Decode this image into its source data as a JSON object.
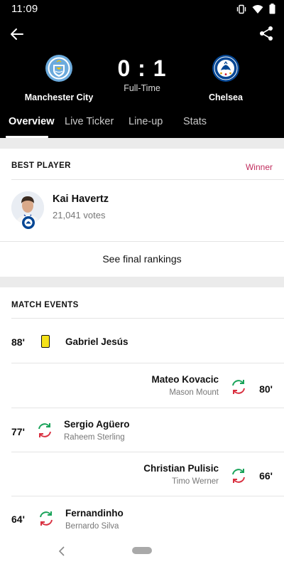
{
  "status_bar": {
    "time": "11:09"
  },
  "match": {
    "home": {
      "name": "Manchester City"
    },
    "away": {
      "name": "Chelsea"
    },
    "score": "0 : 1",
    "status": "Full-Time"
  },
  "tabs": [
    {
      "label": "Overview",
      "active": true
    },
    {
      "label": "Live Ticker",
      "active": false
    },
    {
      "label": "Line-up",
      "active": false
    },
    {
      "label": "Stats",
      "active": false
    }
  ],
  "best_player": {
    "section_title": "BEST PLAYER",
    "winner_label": "Winner",
    "name": "Kai Havertz",
    "votes": "21,041 votes",
    "rankings_button": "See final rankings"
  },
  "match_events": {
    "section_title": "MATCH EVENTS",
    "events": [
      {
        "minute": "88'",
        "type": "yellow-card",
        "side": "home",
        "player": "Gabriel Jesús"
      },
      {
        "minute": "80'",
        "type": "substitution",
        "side": "away",
        "player": "Mateo Kovacic",
        "replaced": "Mason Mount"
      },
      {
        "minute": "77'",
        "type": "substitution",
        "side": "home",
        "player": "Sergio Agüero",
        "replaced": "Raheem Sterling"
      },
      {
        "minute": "66'",
        "type": "substitution",
        "side": "away",
        "player": "Christian Pulisic",
        "replaced": "Timo Werner"
      },
      {
        "minute": "64'",
        "type": "substitution",
        "side": "home",
        "player": "Fernandinho",
        "replaced": "Bernardo Silva"
      }
    ]
  },
  "colors": {
    "header_bg": "#000000",
    "accent_winner": "#c12c5d",
    "yellow_card": "#f5e21a",
    "sub_in": "#1aa35a",
    "sub_out": "#d93040",
    "city_blue": "#6cabdd",
    "chelsea_blue": "#034694"
  }
}
